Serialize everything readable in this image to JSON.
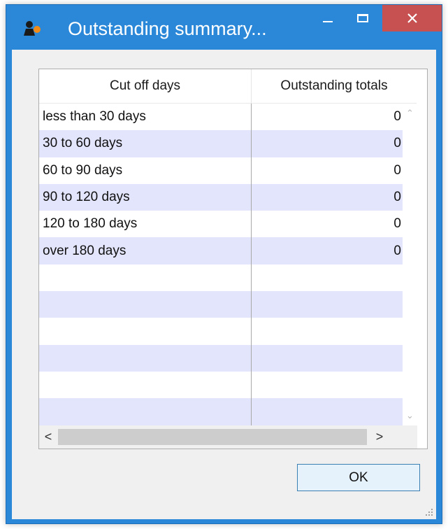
{
  "window": {
    "title": "Outstanding summary...",
    "close_glyph": "✕"
  },
  "grid": {
    "columns": [
      "Cut off days",
      "Outstanding totals"
    ],
    "rows": [
      {
        "days": "less than 30 days",
        "total": "0"
      },
      {
        "days": "30 to 60 days",
        "total": "0"
      },
      {
        "days": "60 to 90 days",
        "total": "0"
      },
      {
        "days": "90 to 120 days",
        "total": "0"
      },
      {
        "days": "120 to 180 days",
        "total": "0"
      },
      {
        "days": "over 180 days",
        "total": "0"
      },
      {
        "days": "",
        "total": ""
      },
      {
        "days": "",
        "total": ""
      },
      {
        "days": "",
        "total": ""
      },
      {
        "days": "",
        "total": ""
      },
      {
        "days": "",
        "total": ""
      },
      {
        "days": "",
        "total": ""
      }
    ],
    "scroll_glyphs": {
      "up": "⌃",
      "down": "⌄",
      "left": "<",
      "right": ">"
    }
  },
  "buttons": {
    "ok_label": "OK"
  },
  "icons": {
    "app": "app-icon",
    "minimize": "minimize-icon",
    "maximize": "maximize-icon",
    "close": "close-icon",
    "grip": "resize-grip-icon"
  },
  "colors": {
    "titlebar": "#2b88d8",
    "close_button": "#c75050",
    "alt_row": "#e3e5fd",
    "ok_border": "#3c7fb1"
  }
}
